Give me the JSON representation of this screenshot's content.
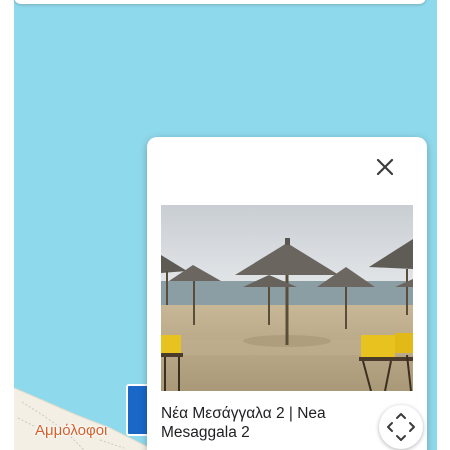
{
  "map": {
    "town_label": "Αμμόλοφοι",
    "water_color": "#8fd9ec"
  },
  "popup": {
    "title_line1": "Νέα Μεσάγγαλα 2 | Nea",
    "title_line2": "Mesaggala 2",
    "close_icon": "close-icon",
    "expand_icon": "expand-arrows-icon",
    "photo_subject": "beach-umbrellas-photo"
  },
  "marker": {
    "icon": "blue-flag-icon",
    "color": "#1a67c8"
  }
}
